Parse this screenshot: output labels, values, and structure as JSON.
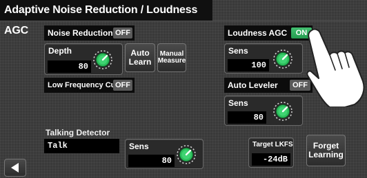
{
  "header": {
    "title": "Adaptive Noise Reduction / Loudness AGC"
  },
  "noise_reduction": {
    "label": "Noise Reduction",
    "state": "OFF",
    "depth": {
      "label": "Depth",
      "value": "80"
    },
    "auto_learn_label": "Auto\nLearn",
    "manual_measure_label": "Manual\nMeasure"
  },
  "low_frequency_cut": {
    "label": "Low Frequency Cut",
    "state": "OFF"
  },
  "talking_detector": {
    "label": "Talking Detector",
    "value": "Talk",
    "sens": {
      "label": "Sens",
      "value": "80"
    }
  },
  "loudness_agc": {
    "label": "Loudness AGC",
    "state": "ON",
    "sens": {
      "label": "Sens",
      "value": "100"
    }
  },
  "auto_leveler": {
    "label": "Auto Leveler",
    "state": "OFF",
    "sens": {
      "label": "Sens",
      "value": "80"
    }
  },
  "target_lkfs": {
    "label": "Target LKFS",
    "value": "-24dB"
  },
  "forget_learning_label": "Forget\nLearning",
  "colors": {
    "knob_green": "#2dbf5c",
    "on_green": "#2fae5e",
    "off_gray": "#5a5a5a"
  },
  "icons": {
    "back": "back-arrow-icon",
    "knob": "knob-icon",
    "hand": "hand-pointer-icon"
  }
}
